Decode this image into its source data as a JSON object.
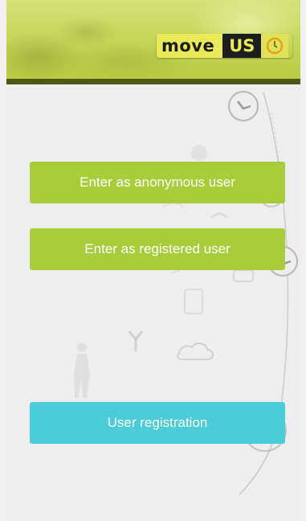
{
  "header": {
    "logo_move": "move",
    "logo_us": "US"
  },
  "buttons": {
    "anonymous_label": "Enter as anonymous user",
    "registered_label": "Enter as registered user",
    "registration_label": "User registration"
  },
  "colors": {
    "accent_green": "#a8cc3a",
    "accent_cyan": "#4ccbd9",
    "header_bar": "#4f5618"
  },
  "icons": [
    "clock-icon",
    "walking-person-icon",
    "cloud-icon",
    "bike-icon",
    "car-icon",
    "sign-icon"
  ]
}
